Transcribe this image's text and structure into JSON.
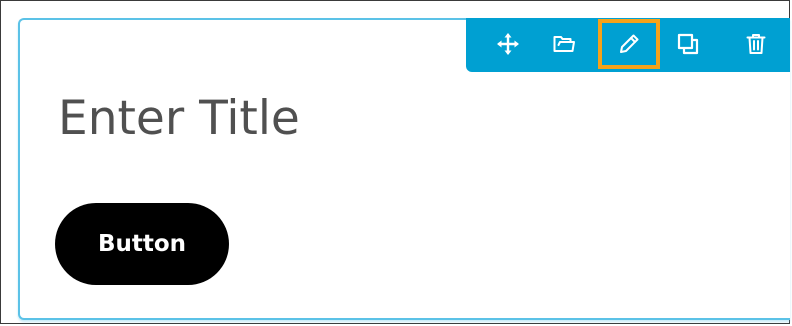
{
  "widget": {
    "title": "Enter Title",
    "button_label": "Button"
  },
  "toolbar": {
    "accent_color": "#00a0d2",
    "highlight_color": "#f6a21a",
    "tools": [
      {
        "icon": "move-icon"
      },
      {
        "icon": "folder-icon"
      },
      {
        "icon": "pencil-icon",
        "highlighted": true
      },
      {
        "icon": "duplicate-icon"
      },
      {
        "icon": "trash-icon"
      }
    ]
  },
  "colors": {
    "widget_border": "#5bc2e7",
    "title_text": "#505050",
    "button_background": "#000000",
    "button_text": "#ffffff"
  }
}
